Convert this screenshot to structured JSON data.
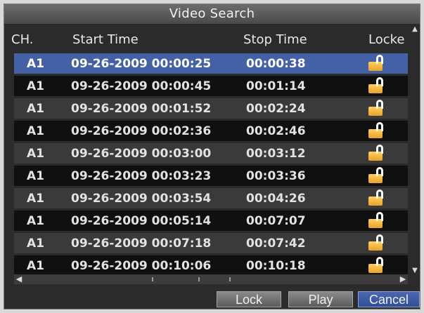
{
  "title": "Video Search",
  "columns": {
    "ch": "CH.",
    "start": "Start Time",
    "stop": "Stop Time",
    "locked": "Locke"
  },
  "rows": [
    {
      "ch": "A1",
      "start": "09-26-2009 00:00:25",
      "stop": "00:00:38",
      "locked": "unlock-icon"
    },
    {
      "ch": "A1",
      "start": "09-26-2009 00:00:45",
      "stop": "00:01:14",
      "locked": "unlock-icon"
    },
    {
      "ch": "A1",
      "start": "09-26-2009 00:01:52",
      "stop": "00:02:24",
      "locked": "unlock-icon"
    },
    {
      "ch": "A1",
      "start": "09-26-2009 00:02:36",
      "stop": "00:02:46",
      "locked": "unlock-icon"
    },
    {
      "ch": "A1",
      "start": "09-26-2009 00:03:00",
      "stop": "00:03:12",
      "locked": "unlock-icon"
    },
    {
      "ch": "A1",
      "start": "09-26-2009 00:03:23",
      "stop": "00:03:36",
      "locked": "unlock-icon"
    },
    {
      "ch": "A1",
      "start": "09-26-2009 00:03:54",
      "stop": "00:04:26",
      "locked": "unlock-icon"
    },
    {
      "ch": "A1",
      "start": "09-26-2009 00:05:14",
      "stop": "00:07:07",
      "locked": "unlock-icon"
    },
    {
      "ch": "A1",
      "start": "09-26-2009 00:07:18",
      "stop": "00:07:42",
      "locked": "unlock-icon"
    },
    {
      "ch": "A1",
      "start": "09-26-2009 00:10:06",
      "stop": "00:10:18",
      "locked": "unlock-icon"
    }
  ],
  "buttons": {
    "lock": "Lock",
    "play": "Play",
    "cancel": "Cancel"
  },
  "colors": {
    "selected_row": "#4561a6",
    "lock_icon": "#f3b53d",
    "primary_button": "#2f4f95"
  }
}
